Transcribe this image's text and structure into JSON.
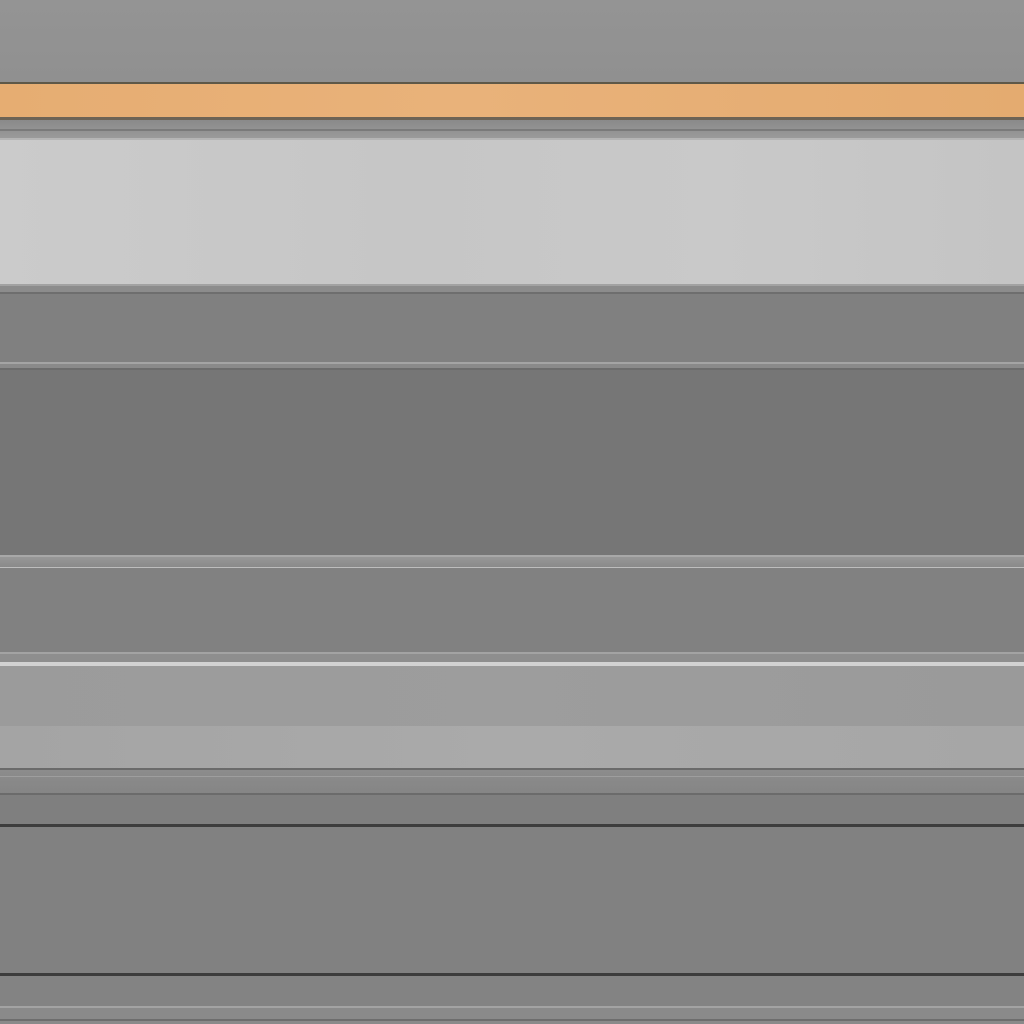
{
  "title": "",
  "colors": {
    "accent": "#e8b078",
    "light_panel": "#c8c8c8",
    "dark_panel": "#767676",
    "mid_panel": "#818181",
    "background": "#929292"
  },
  "regions": [
    {
      "name": "top-strip",
      "text": ""
    },
    {
      "name": "accent-bar",
      "text": ""
    },
    {
      "name": "light-panel",
      "text": ""
    },
    {
      "name": "mid-panel",
      "text": ""
    },
    {
      "name": "dark-panel",
      "text": ""
    },
    {
      "name": "mid-panel-2",
      "text": ""
    },
    {
      "name": "light-panel-2",
      "text": ""
    },
    {
      "name": "lower-panel",
      "text": ""
    },
    {
      "name": "bottom-strip",
      "text": ""
    }
  ]
}
